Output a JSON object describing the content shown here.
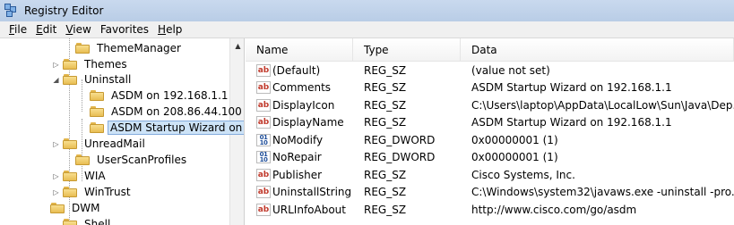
{
  "window": {
    "title": "Registry Editor",
    "app_icon": "registry-editor-icon"
  },
  "menu": [
    {
      "underline": "F",
      "rest": "ile"
    },
    {
      "underline": "E",
      "rest": "dit"
    },
    {
      "underline": "V",
      "rest": "iew"
    },
    {
      "underline": "",
      "rest": "Favorites"
    },
    {
      "underline": "H",
      "rest": "elp"
    }
  ],
  "tree": {
    "items": [
      {
        "label": "ThemeManager",
        "expander": ""
      },
      {
        "label": "Themes",
        "expander": "▷"
      },
      {
        "label": "Uninstall",
        "expander": "◢"
      },
      {
        "label": "ASDM on 192.168.1.1",
        "expander": ""
      },
      {
        "label": "ASDM on 208.86.44.100",
        "expander": ""
      },
      {
        "label": "ASDM Startup Wizard on",
        "expander": "",
        "selected": true
      },
      {
        "label": "UnreadMail",
        "expander": "▷"
      },
      {
        "label": "UserScanProfiles",
        "expander": ""
      },
      {
        "label": "WIA",
        "expander": "▷"
      },
      {
        "label": "WinTrust",
        "expander": "▷"
      },
      {
        "label": "DWM",
        "expander": ""
      },
      {
        "label": "Shell",
        "expander": ""
      }
    ]
  },
  "list": {
    "columns": {
      "name": "Name",
      "type": "Type",
      "data": "Data"
    },
    "rows": [
      {
        "icon": "ab",
        "kind": "string-value-icon",
        "name": "(Default)",
        "type": "REG_SZ",
        "data": "(value not set)"
      },
      {
        "icon": "ab",
        "kind": "string-value-icon",
        "name": "Comments",
        "type": "REG_SZ",
        "data": "ASDM Startup Wizard on 192.168.1.1"
      },
      {
        "icon": "ab",
        "kind": "string-value-icon",
        "name": "DisplayIcon",
        "type": "REG_SZ",
        "data": "C:\\Users\\laptop\\AppData\\LocalLow\\Sun\\Java\\Dep..."
      },
      {
        "icon": "ab",
        "kind": "string-value-icon",
        "name": "DisplayName",
        "type": "REG_SZ",
        "data": "ASDM Startup Wizard on 192.168.1.1"
      },
      {
        "icon": "01",
        "kind": "dword-value-icon",
        "name": "NoModify",
        "type": "REG_DWORD",
        "data": "0x00000001 (1)"
      },
      {
        "icon": "01",
        "kind": "dword-value-icon",
        "name": "NoRepair",
        "type": "REG_DWORD",
        "data": "0x00000001 (1)"
      },
      {
        "icon": "ab",
        "kind": "string-value-icon",
        "name": "Publisher",
        "type": "REG_SZ",
        "data": "Cisco Systems, Inc."
      },
      {
        "icon": "ab",
        "kind": "string-value-icon",
        "name": "UninstallString",
        "type": "REG_SZ",
        "data": "C:\\Windows\\system32\\javaws.exe -uninstall -pro..."
      },
      {
        "icon": "ab",
        "kind": "string-value-icon",
        "name": "URLInfoAbout",
        "type": "REG_SZ",
        "data": "http://www.cisco.com/go/asdm"
      }
    ]
  }
}
